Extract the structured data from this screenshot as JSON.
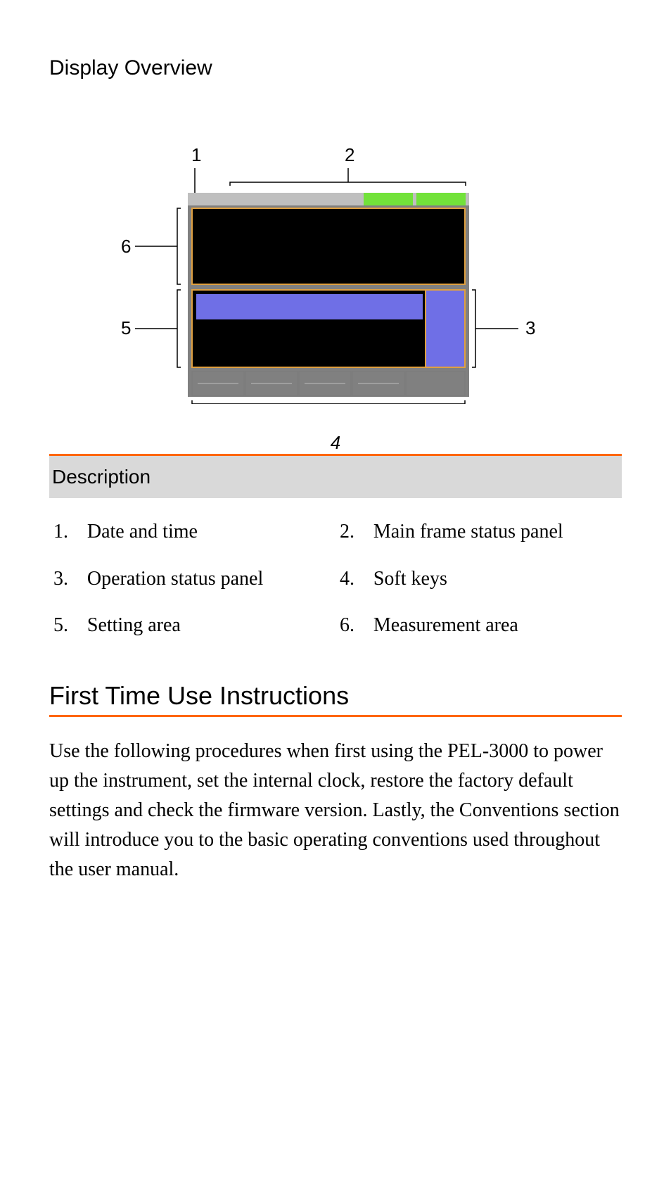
{
  "section_title": "Display Overview",
  "callouts": {
    "n1": "1",
    "n2": "2",
    "n3": "3",
    "n4": "4",
    "n5": "5",
    "n6": "6"
  },
  "description_header": "Description",
  "items": [
    {
      "num": "1.",
      "text": "Date and time"
    },
    {
      "num": "2.",
      "text": "Main frame status panel"
    },
    {
      "num": "3.",
      "text": "Operation status panel"
    },
    {
      "num": "4.",
      "text": "Soft keys"
    },
    {
      "num": "5.",
      "text": "Setting area"
    },
    {
      "num": "6.",
      "text": "Measurement area"
    }
  ],
  "instructions_title": "First Time Use Instructions",
  "instructions_body": "Use the following procedures when first using the PEL-3000 to power up the instrument, set the internal clock, restore the factory default settings and check the firmware version. Lastly, the Conventions section will introduce you to the basic operating conventions used throughout the user manual."
}
